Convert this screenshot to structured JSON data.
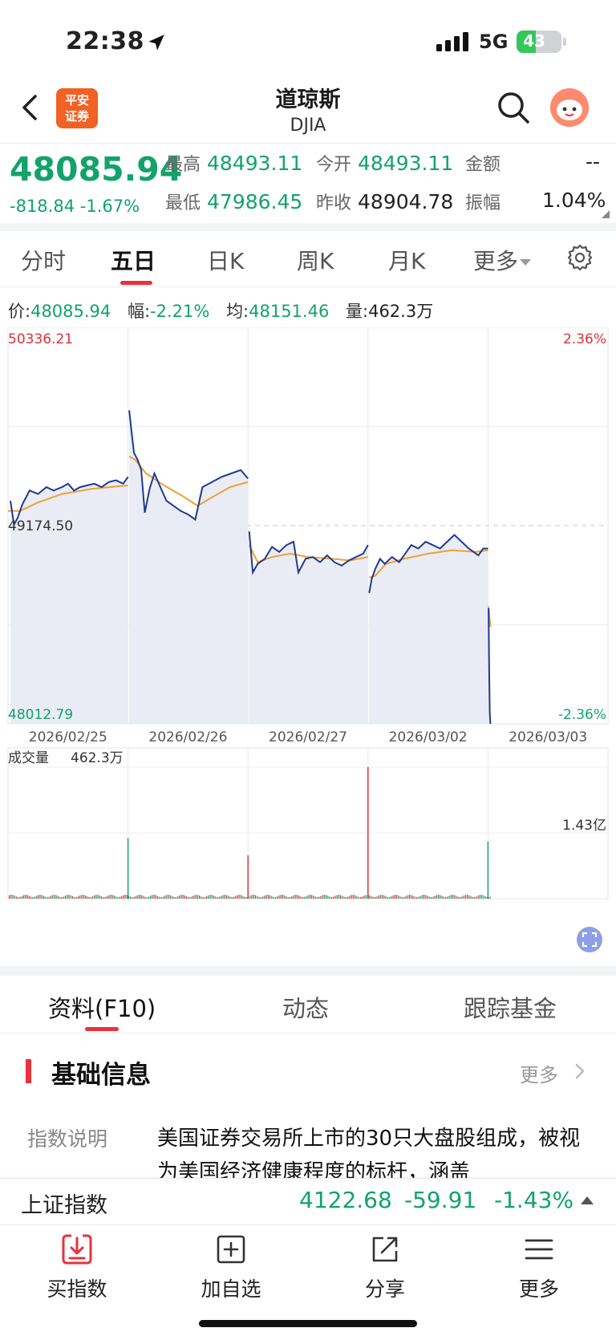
{
  "status_bar": {
    "time": "22:38",
    "network": "5G",
    "battery": "43",
    "battery_level": 0.43
  },
  "header": {
    "title": "道琼斯",
    "subtitle": "DJIA",
    "logo_text": [
      "平安",
      "证券"
    ]
  },
  "quote": {
    "price": "48085.94",
    "change": "-818.84",
    "change_pct": "-1.67%",
    "high_label": "最高",
    "high": "48493.11",
    "open_label": "今开",
    "open": "48493.11",
    "amount_label": "金额",
    "amount": "--",
    "low_label": "最低",
    "low": "47986.45",
    "prev_close_label": "昨收",
    "prev_close": "48904.78",
    "amplitude_label": "振幅",
    "amplitude": "1.04%"
  },
  "period_tabs": [
    "分时",
    "五日",
    "日K",
    "周K",
    "月K",
    "更多"
  ],
  "active_period": "五日",
  "info_line": {
    "price_label": "价:",
    "price": "48085.94",
    "range_label": "幅:",
    "range": "-2.21%",
    "avg_label": "均:",
    "avg": "48151.46",
    "vol_label": "量:",
    "vol": "462.3万"
  },
  "chart_data": {
    "type": "line",
    "price_axis": {
      "top": "50336.21",
      "mid": "49174.50",
      "bottom": "48012.79",
      "top_pct": "2.36%",
      "bottom_pct": "-2.36%",
      "ylim": [
        48012.79,
        50336.21
      ]
    },
    "dates": [
      "2026/02/25",
      "2026/02/26",
      "2026/02/27",
      "2026/03/02",
      "2026/03/03"
    ],
    "series": [
      {
        "key": "price",
        "color": "#1f3a93",
        "points": [
          [
            0,
            49280
          ],
          [
            0.02,
            49320
          ],
          [
            0.05,
            49180
          ],
          [
            0.08,
            49220
          ],
          [
            0.12,
            49300
          ],
          [
            0.18,
            49380
          ],
          [
            0.25,
            49360
          ],
          [
            0.32,
            49400
          ],
          [
            0.38,
            49380
          ],
          [
            0.45,
            49400
          ],
          [
            0.5,
            49420
          ],
          [
            0.55,
            49380
          ],
          [
            0.6,
            49400
          ],
          [
            0.66,
            49410
          ],
          [
            0.72,
            49420
          ],
          [
            0.78,
            49400
          ],
          [
            0.84,
            49430
          ],
          [
            0.9,
            49440
          ],
          [
            0.96,
            49420
          ],
          [
            1.0,
            49460
          ],
          [
            1.01,
            49850
          ],
          [
            1.03,
            49720
          ],
          [
            1.05,
            49600
          ],
          [
            1.08,
            49560
          ],
          [
            1.11,
            49500
          ],
          [
            1.14,
            49250
          ],
          [
            1.18,
            49390
          ],
          [
            1.22,
            49480
          ],
          [
            1.27,
            49400
          ],
          [
            1.32,
            49320
          ],
          [
            1.38,
            49290
          ],
          [
            1.44,
            49260
          ],
          [
            1.5,
            49240
          ],
          [
            1.56,
            49210
          ],
          [
            1.62,
            49400
          ],
          [
            1.7,
            49430
          ],
          [
            1.78,
            49460
          ],
          [
            1.86,
            49480
          ],
          [
            1.94,
            49500
          ],
          [
            2.0,
            49450
          ],
          [
            2.01,
            49140
          ],
          [
            2.04,
            48900
          ],
          [
            2.08,
            48950
          ],
          [
            2.14,
            48980
          ],
          [
            2.2,
            49050
          ],
          [
            2.26,
            49020
          ],
          [
            2.32,
            49060
          ],
          [
            2.38,
            49080
          ],
          [
            2.42,
            48900
          ],
          [
            2.48,
            48980
          ],
          [
            2.54,
            48990
          ],
          [
            2.6,
            48960
          ],
          [
            2.66,
            49000
          ],
          [
            2.72,
            48960
          ],
          [
            2.78,
            48940
          ],
          [
            2.84,
            48970
          ],
          [
            2.9,
            48990
          ],
          [
            2.96,
            49010
          ],
          [
            3.0,
            49060
          ],
          [
            3.01,
            48780
          ],
          [
            3.03,
            48860
          ],
          [
            3.06,
            48920
          ],
          [
            3.1,
            48980
          ],
          [
            3.14,
            48950
          ],
          [
            3.2,
            48990
          ],
          [
            3.26,
            48960
          ],
          [
            3.3,
            49000
          ],
          [
            3.36,
            49060
          ],
          [
            3.42,
            49040
          ],
          [
            3.48,
            49080
          ],
          [
            3.54,
            49060
          ],
          [
            3.6,
            49040
          ],
          [
            3.66,
            49080
          ],
          [
            3.72,
            49120
          ],
          [
            3.78,
            49080
          ],
          [
            3.84,
            49040
          ],
          [
            3.88,
            49020
          ],
          [
            3.92,
            49000
          ],
          [
            3.96,
            49040
          ],
          [
            4.0,
            49040
          ],
          [
            4.005,
            48690
          ],
          [
            4.01,
            48320
          ],
          [
            4.015,
            48080
          ],
          [
            4.02,
            48012
          ]
        ]
      },
      {
        "key": "average",
        "color": "#f0a030",
        "points": [
          [
            0,
            49260
          ],
          [
            0.1,
            49260
          ],
          [
            0.25,
            49310
          ],
          [
            0.45,
            49360
          ],
          [
            0.7,
            49390
          ],
          [
            1.0,
            49410
          ],
          [
            1.01,
            49580
          ],
          [
            1.06,
            49560
          ],
          [
            1.15,
            49480
          ],
          [
            1.3,
            49410
          ],
          [
            1.45,
            49350
          ],
          [
            1.58,
            49290
          ],
          [
            1.7,
            49340
          ],
          [
            1.85,
            49400
          ],
          [
            2.0,
            49430
          ],
          [
            2.01,
            49060
          ],
          [
            2.08,
            48960
          ],
          [
            2.2,
            48990
          ],
          [
            2.35,
            49010
          ],
          [
            2.5,
            48990
          ],
          [
            2.7,
            48980
          ],
          [
            2.85,
            48970
          ],
          [
            3.0,
            48990
          ],
          [
            3.01,
            48870
          ],
          [
            3.06,
            48880
          ],
          [
            3.15,
            48950
          ],
          [
            3.3,
            48980
          ],
          [
            3.5,
            49010
          ],
          [
            3.7,
            49030
          ],
          [
            3.9,
            49020
          ],
          [
            4.0,
            49030
          ],
          [
            4.005,
            48700
          ],
          [
            4.02,
            48580
          ]
        ]
      }
    ],
    "volume": {
      "label": "成交量",
      "value": "462.3万",
      "axis_mid": "1.43亿",
      "max": 2.0,
      "spikes": [
        {
          "x": 1.0,
          "v": 0.92,
          "color": "#12a36b"
        },
        {
          "x": 2.0,
          "v": 0.66,
          "color": "#e0303c"
        },
        {
          "x": 3.0,
          "v": 2.0,
          "color": "#e0303c"
        },
        {
          "x": 4.0,
          "v": 0.87,
          "color": "#12a36b"
        }
      ]
    }
  },
  "lower_tabs": [
    "资料(F10)",
    "动态",
    "跟踪基金"
  ],
  "section": {
    "title": "基础信息",
    "more": "更多",
    "desc_label": "指数说明",
    "desc_text": "美国证券交易所上市的30只大盘股组成，被视为美国经济健康程度的标杆，涵盖"
  },
  "ticker": {
    "name": "上证指数",
    "price": "4122.68",
    "change": "-59.91",
    "pct": "-1.43%"
  },
  "toolbar": [
    "买指数",
    "加自选",
    "分享",
    "更多"
  ],
  "colors": {
    "accent_red": "#e8323c",
    "down_green": "#12a36b",
    "price_line": "#1f3a93",
    "avg_line": "#f0a030"
  }
}
